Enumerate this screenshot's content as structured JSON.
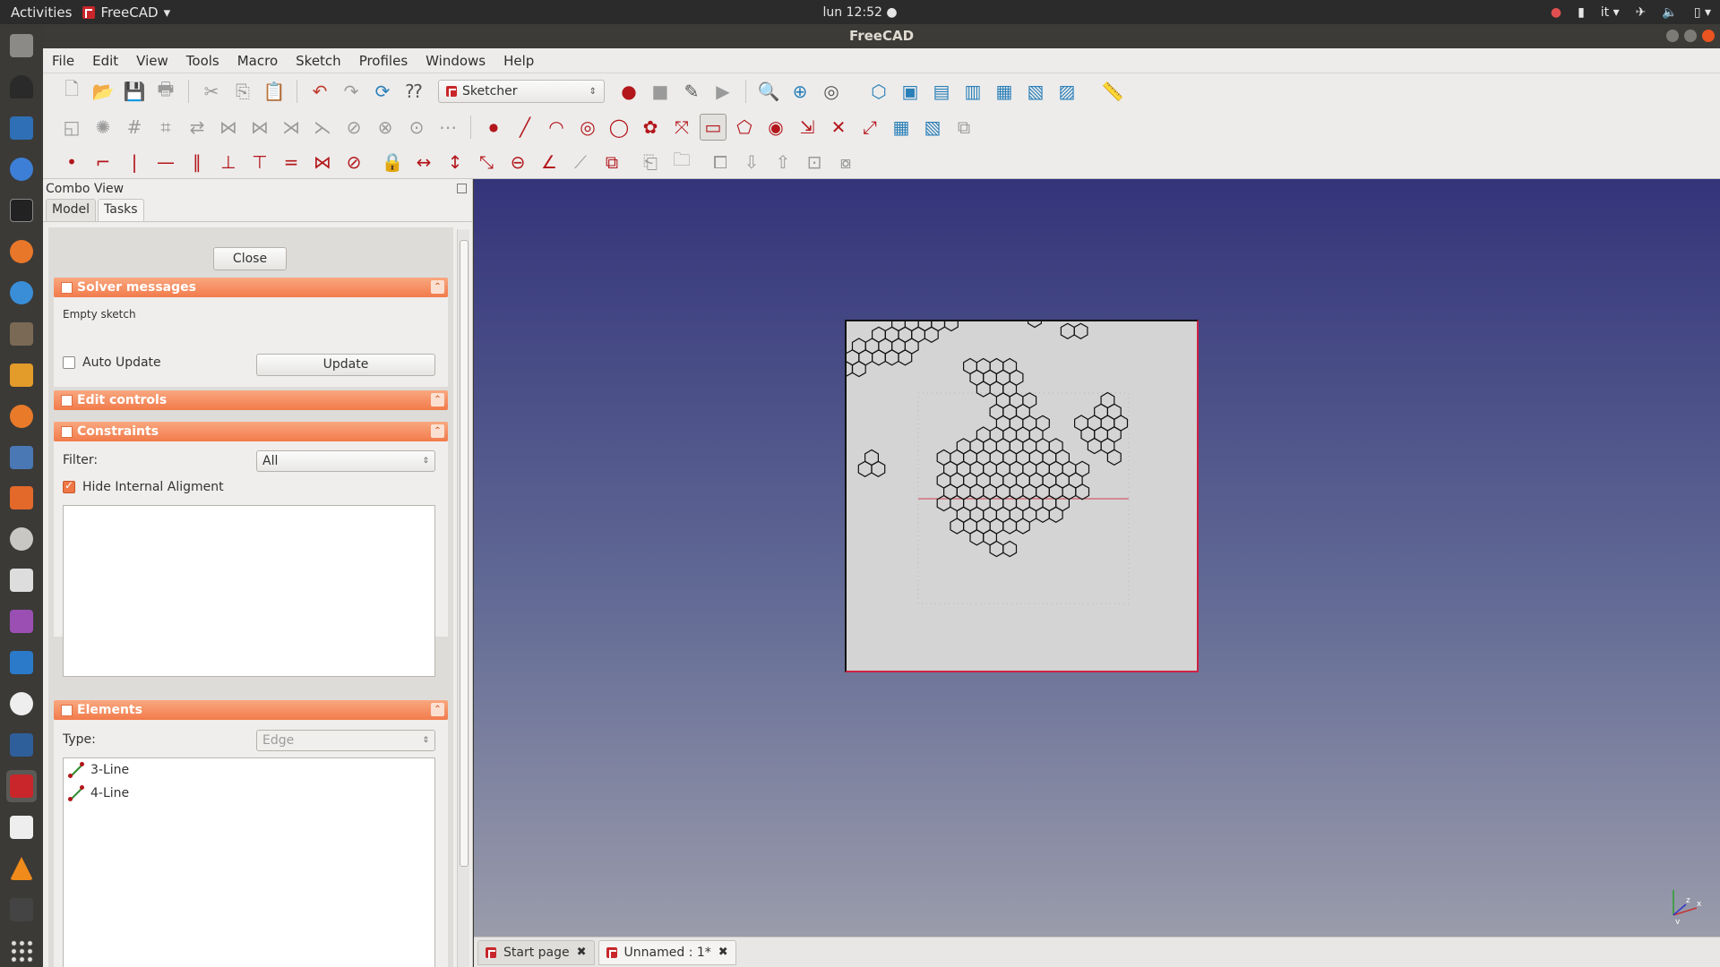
{
  "topbar": {
    "activities": "Activities",
    "app_name": "FreeCAD",
    "app_menu_arrow": "▾",
    "clock": "lun 12:52 ●",
    "tray": [
      "●",
      "▮",
      "it ▾",
      "✈",
      "🔈",
      "▯ ▾"
    ]
  },
  "window": {
    "title": "FreeCAD"
  },
  "menu": [
    "File",
    "Edit",
    "View",
    "Tools",
    "Macro",
    "Sketch",
    "Profiles",
    "Windows",
    "Help"
  ],
  "toolbar": {
    "workbench": "Sketcher",
    "row1": [
      "🗋",
      "📂",
      "💾",
      "🖶",
      "✂",
      "⎘",
      "📋",
      "↶",
      "↷",
      "⟳",
      "⁇"
    ],
    "row1b": [
      "●",
      "■",
      "✎",
      "▶",
      "🔍",
      "⊕",
      "◎",
      "⬡",
      "▣",
      "▤",
      "▥",
      "▦",
      "▧",
      "▨",
      "📏"
    ],
    "row2": [
      "◱",
      "✺",
      "#",
      "⌗",
      "⇄",
      "⋈",
      "⋈",
      "⋊",
      "⋋",
      "⊘",
      "⊗",
      "⊙",
      "⋯",
      "●",
      "╱",
      "◠",
      "◎",
      "◯",
      "✿",
      "⤧",
      "▭",
      "⬠",
      "◉",
      "⇲",
      "✕",
      "⤢",
      "▦",
      "▧",
      "⧉"
    ],
    "row3": [
      "•",
      "⌐",
      "|",
      "—",
      "∥",
      "⊥",
      "⊤",
      "=",
      "⋈",
      "⊘",
      "🔒",
      "↔",
      "↕",
      "⤡",
      "⊖",
      "∠",
      "⟋",
      "⧉",
      "⎗",
      "🗀",
      "⧠",
      "⇩",
      "⇧",
      "⊡",
      "⧇"
    ]
  },
  "combo": {
    "title": "Combo View",
    "tabs": [
      "Model",
      "Tasks"
    ],
    "close_button": "Close",
    "solver": {
      "title": "Solver messages",
      "message": "Empty sketch",
      "auto_update": "Auto Update",
      "update_button": "Update"
    },
    "edit_controls": {
      "title": "Edit controls"
    },
    "constraints": {
      "title": "Constraints",
      "filter_label": "Filter:",
      "filter_value": "All",
      "hide_internal": "Hide Internal Aligment"
    },
    "elements": {
      "title": "Elements",
      "type_label": "Type:",
      "type_value": "Edge",
      "items": [
        "3-Line",
        "4-Line"
      ]
    },
    "fold_glyph": "⌃"
  },
  "doc_tabs": [
    {
      "label": "Start page",
      "close": "✖"
    },
    {
      "label": "Unnamed : 1*",
      "close": "✖"
    }
  ],
  "axis": {
    "x": "x",
    "y": "y",
    "z": "z"
  },
  "colors": {
    "accent": "#f27b4b",
    "view_top": "#33347a",
    "view_bottom": "#9a9cab",
    "constraint_red": "#b3161b"
  }
}
